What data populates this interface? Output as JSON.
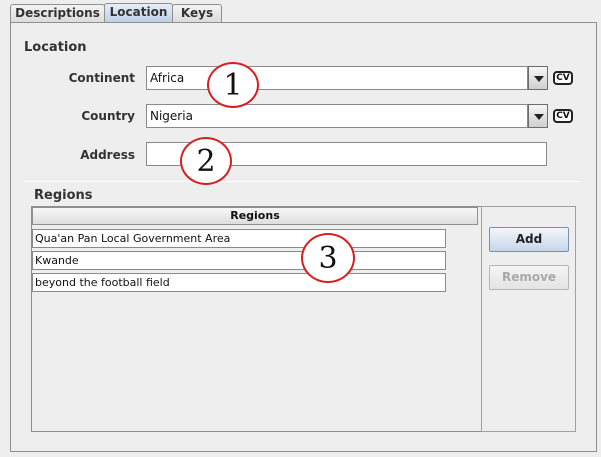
{
  "tabs": [
    {
      "label": "Descriptions",
      "selected": false
    },
    {
      "label": "Location",
      "selected": true
    },
    {
      "label": "Keys",
      "selected": false
    }
  ],
  "location": {
    "section_title": "Location",
    "continent": {
      "label": "Continent",
      "value": "Africa",
      "badge": "CV"
    },
    "country": {
      "label": "Country",
      "value": "Nigeria",
      "badge": "CV"
    },
    "address": {
      "label": "Address",
      "value": ""
    }
  },
  "regions": {
    "section_title": "Regions",
    "column_header": "Regions",
    "rows": [
      "Qua'an Pan Local Government Area",
      "Kwande",
      "beyond the football field"
    ],
    "add_label": "Add",
    "remove_label": "Remove"
  },
  "callouts": [
    "1",
    "2",
    "3"
  ],
  "colors": {
    "callout_border": "#d62020",
    "selected_tab": "#bfd0e6"
  },
  "icons": {
    "combo_arrow": "chevron-down-icon",
    "cv_badge": "cv-badge-icon"
  }
}
